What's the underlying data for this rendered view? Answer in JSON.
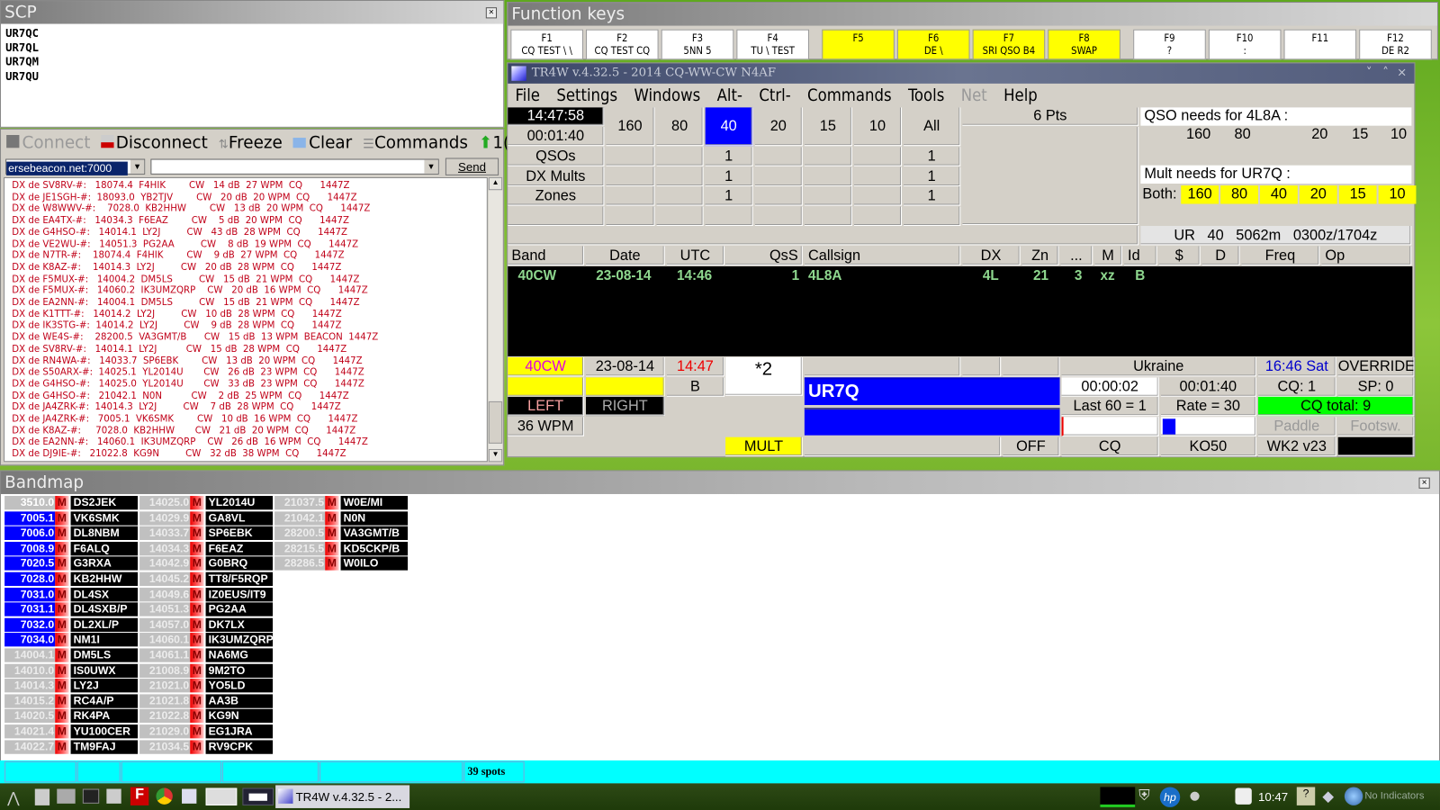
{
  "scp": {
    "title": "SCP",
    "items": [
      "UR7QC",
      "UR7QL",
      "UR7QM",
      "UR7QU"
    ]
  },
  "cluster": {
    "toolbar": {
      "connect": "Connect",
      "disconnect": "Disconnect",
      "freeze": "Freeze",
      "clear": "Clear",
      "commands": "Commands",
      "extra": "1("
    },
    "server": "ersebeacon.net:7000",
    "command_value": "",
    "send": "Send",
    "lines": [
      "DX de SV8RV-#:   18074.4  F4HIK        CW   14 dB  27 WPM  CQ      1447Z",
      "DX de JE1SGH-#:  18093.0  YB2TJV        CW   20 dB  20 WPM  CQ      1447Z",
      "DX de W8WWV-#:    7028.0  KB2HHW        CW   13 dB  20 WPM  CQ      1447Z",
      "DX de EA4TX-#:   14034.3  F6EAZ        CW    5 dB  20 WPM  CQ      1447Z",
      "DX de G4HSO-#:   14014.1  LY2J         CW   43 dB  28 WPM  CQ      1447Z",
      "DX de VE2WU-#:   14051.3  PG2AA         CW    8 dB  19 WPM  CQ      1447Z",
      "DX de N7TR-#:    18074.4  F4HIK        CW    9 dB  27 WPM  CQ      1447Z",
      "DX de K8AZ-#:    14014.3  LY2J         CW   20 dB  28 WPM  CQ      1447Z",
      "DX de F5MUX-#:   14004.2  DM5LS         CW   15 dB  21 WPM  CQ      1447Z",
      "DX de F5MUX-#:   14060.2  IK3UMZQRP    CW   20 dB  16 WPM  CQ      1447Z",
      "DX de EA2NN-#:   14004.1  DM5LS         CW   15 dB  21 WPM  CQ      1447Z",
      "DX de K1TTT-#:   14014.2  LY2J         CW   10 dB  28 WPM  CQ      1447Z",
      "DX de IK3STG-#:  14014.2  LY2J         CW    9 dB  28 WPM  CQ      1447Z",
      "DX de WE4S-#:    28200.5  VA3GMT/B      CW   15 dB  13 WPM  BEACON  1447Z",
      "DX de SV8RV-#:   14014.1  LY2J          CW   15 dB  28 WPM  CQ      1447Z",
      "DX de RN4WA-#:   14033.7  SP6EBK        CW   13 dB  20 WPM  CQ      1447Z",
      "DX de S50ARX-#:  14025.1  YL2014U       CW   26 dB  23 WPM  CQ      1447Z",
      "DX de G4HSO-#:   14025.0  YL2014U       CW   33 dB  23 WPM  CQ      1447Z",
      "DX de G4HSO-#:   21042.1  N0N          CW    2 dB  25 WPM  CQ      1447Z",
      "DX de JA4ZRK-#:  14014.3  LY2J         CW    7 dB  28 WPM  CQ      1447Z",
      "DX de JA4ZRK-#:   7005.1  VK6SMK        CW   10 dB  16 WPM  CQ      1447Z",
      "DX de K8AZ-#:     7028.0  KB2HHW       CW   21 dB  20 WPM  CQ      1447Z",
      "DX de EA2NN-#:   14060.1  IK3UMZQRP    CW   26 dB  16 WPM  CQ      1447Z",
      "DX de DJ9IE-#:   21022.8  KG9N         CW   32 dB  38 WPM  CQ      1447Z"
    ]
  },
  "fkeys": {
    "title": "Function keys",
    "keys": [
      {
        "key": "F1",
        "label": "CQ TEST \\ \\",
        "hl": false
      },
      {
        "key": "F2",
        "label": "CQ TEST CQ",
        "hl": false
      },
      {
        "key": "F3",
        "label": "5NN 5",
        "hl": false
      },
      {
        "key": "F4",
        "label": "TU \\ TEST",
        "hl": false
      },
      {
        "key": "F5",
        "label": "",
        "hl": true
      },
      {
        "key": "F6",
        "label": "DE \\",
        "hl": true
      },
      {
        "key": "F7",
        "label": "SRI QSO B4",
        "hl": true
      },
      {
        "key": "F8",
        "label": "SWAP",
        "hl": true
      },
      {
        "key": "F9",
        "label": "?",
        "hl": false
      },
      {
        "key": "F10",
        "label": ":",
        "hl": false
      },
      {
        "key": "F11",
        "label": "",
        "hl": false
      },
      {
        "key": "F12",
        "label": "DE R2",
        "hl": false
      }
    ]
  },
  "main": {
    "title": "TR4W v.4.32.5 - 2014 CQ-WW-CW N4AF",
    "menu": [
      "File",
      "Settings",
      "Windows",
      "Alt-",
      "Ctrl-",
      "Commands",
      "Tools",
      "Net",
      "Help"
    ],
    "clock": "14:47:58",
    "elapsed": "00:01:40",
    "bands": [
      "160",
      "80",
      "40",
      "20",
      "15",
      "10",
      "All"
    ],
    "active_band": "40",
    "rows": [
      {
        "label": "QSOs",
        "values": [
          "",
          "",
          "1",
          "",
          "",
          "",
          "1"
        ]
      },
      {
        "label": "DX Mults",
        "values": [
          "",
          "",
          "1",
          "",
          "",
          "",
          "1"
        ]
      },
      {
        "label": "Zones",
        "values": [
          "",
          "",
          "1",
          "",
          "",
          "",
          "1"
        ]
      },
      {
        "label": "",
        "values": [
          "",
          "",
          "",
          "",
          "",
          "",
          ""
        ]
      }
    ],
    "points": "6 Pts",
    "qso_needs_title": "QSO needs for 4L8A :",
    "qso_needs": [
      "160",
      "80",
      "",
      "20",
      "15",
      "10"
    ],
    "mult_needs_title": "Mult needs for UR7Q :",
    "mult_both_label": "Both:",
    "mult_needs": [
      "160",
      "80",
      "40",
      "20",
      "15",
      "10"
    ],
    "beam": "UR   40   5062m   0300z/1704z",
    "log_headers": [
      "Band",
      "Date",
      "UTC",
      "QsS",
      "Callsign",
      "DX",
      "Zn",
      "...",
      "M",
      "Id",
      "$",
      "D",
      "Freq",
      "Op"
    ],
    "log_row": {
      "band": "40CW",
      "date": "23-08-14",
      "utc": "14:46",
      "qss": "1",
      "call": "4L8A",
      "dx": "4L",
      "zn": "21",
      "dots": "3",
      "m": "xz",
      "id": "B"
    },
    "entry": {
      "band": "40CW",
      "date": "23-08-14",
      "time": "14:47",
      "serial": "*2",
      "radio": "B",
      "country": "Ukraine",
      "local_time": "16:46 Sat",
      "override": "OVERRIDE",
      "callsign": "UR7Q",
      "timer1": "00:00:02",
      "timer2": "00:01:40",
      "cq_count": "CQ: 1",
      "sp_count": "SP: 0",
      "left": "LEFT",
      "right": "RIGHT",
      "last60": "Last 60 = 1",
      "rate": "Rate = 30",
      "cq_total": "CQ total: 9",
      "wpm": "36 WPM",
      "paddle": "Paddle",
      "footsw": "Footsw.",
      "mult": "MULT",
      "off": "OFF",
      "mode": "CQ",
      "grid": "KO50",
      "keyer": "WK2 v23"
    }
  },
  "bandmap": {
    "title": "Bandmap",
    "spots_label": "39 spots",
    "columns": [
      [
        {
          "f": "3510.0",
          "c": "DS2JEK",
          "hl": false,
          "bright": true
        },
        {
          "f": "7005.1",
          "c": "VK6SMK",
          "hl": true
        },
        {
          "f": "7006.0",
          "c": "DL8NBM",
          "hl": true
        },
        {
          "f": "7008.9",
          "c": "F6ALQ",
          "hl": true
        },
        {
          "f": "7020.5",
          "c": "G3RXA",
          "hl": true
        },
        {
          "f": "7028.0",
          "c": "KB2HHW",
          "hl": true
        },
        {
          "f": "7031.0",
          "c": "DL4SX",
          "hl": true
        },
        {
          "f": "7031.1",
          "c": "DL4SXB/P",
          "hl": true
        },
        {
          "f": "7032.0",
          "c": "DL2XL/P",
          "hl": true
        },
        {
          "f": "7034.0",
          "c": "NM1I",
          "hl": true
        },
        {
          "f": "14004.1",
          "c": "DM5LS",
          "hl": false
        },
        {
          "f": "14010.0",
          "c": "IS0UWX",
          "hl": false
        },
        {
          "f": "14014.3",
          "c": "LY2J",
          "hl": false
        },
        {
          "f": "14015.2",
          "c": "RC4A/P",
          "hl": false
        },
        {
          "f": "14020.5",
          "c": "RK4PA",
          "hl": false
        },
        {
          "f": "14021.4",
          "c": "YU100CER",
          "hl": false
        },
        {
          "f": "14022.7",
          "c": "TM9FAJ",
          "hl": false
        }
      ],
      [
        {
          "f": "14025.0",
          "c": "YL2014U",
          "hl": false
        },
        {
          "f": "14029.9",
          "c": "GA8VL",
          "hl": false
        },
        {
          "f": "14033.7",
          "c": "SP6EBK",
          "hl": false
        },
        {
          "f": "14034.3",
          "c": "F6EAZ",
          "hl": false
        },
        {
          "f": "14042.9",
          "c": "G0BRQ",
          "hl": false
        },
        {
          "f": "14045.2",
          "c": "TT8/F5RQP",
          "hl": false
        },
        {
          "f": "14049.6",
          "c": "IZ0EUS/IT9",
          "hl": false
        },
        {
          "f": "14051.3",
          "c": "PG2AA",
          "hl": false
        },
        {
          "f": "14057.0",
          "c": "DK7LX",
          "hl": false
        },
        {
          "f": "14060.1",
          "c": "IK3UMZQRP",
          "hl": false
        },
        {
          "f": "14061.1",
          "c": "NA6MG",
          "hl": false
        },
        {
          "f": "21008.9",
          "c": "9M2TO",
          "hl": false
        },
        {
          "f": "21021.0",
          "c": "YO5LD",
          "hl": false
        },
        {
          "f": "21021.8",
          "c": "AA3B",
          "hl": false
        },
        {
          "f": "21022.8",
          "c": "KG9N",
          "hl": false
        },
        {
          "f": "21029.0",
          "c": "EG1JRA",
          "hl": false
        },
        {
          "f": "21034.5",
          "c": "RV9CPK",
          "hl": false
        }
      ],
      [
        {
          "f": "21037.5",
          "c": "W0E/MI",
          "hl": false
        },
        {
          "f": "21042.1",
          "c": "N0N",
          "hl": false
        },
        {
          "f": "28200.5",
          "c": "VA3GMT/B",
          "hl": false
        },
        {
          "f": "28215.5",
          "c": "KD5CKP/B",
          "hl": false
        },
        {
          "f": "28286.5",
          "c": "W0ILO",
          "hl": false
        }
      ]
    ],
    "mult_marker": "M"
  },
  "taskbar": {
    "task": "TR4W v.4.32.5 - 2...",
    "clock": "10:47",
    "indicators": "No Indicators"
  },
  "colors": {
    "active_band": "#0000ff",
    "highlight": "#ffff00",
    "cq_total": "#00ff00",
    "status_bar": "#00ffff",
    "cluster_text": "#c00018"
  }
}
